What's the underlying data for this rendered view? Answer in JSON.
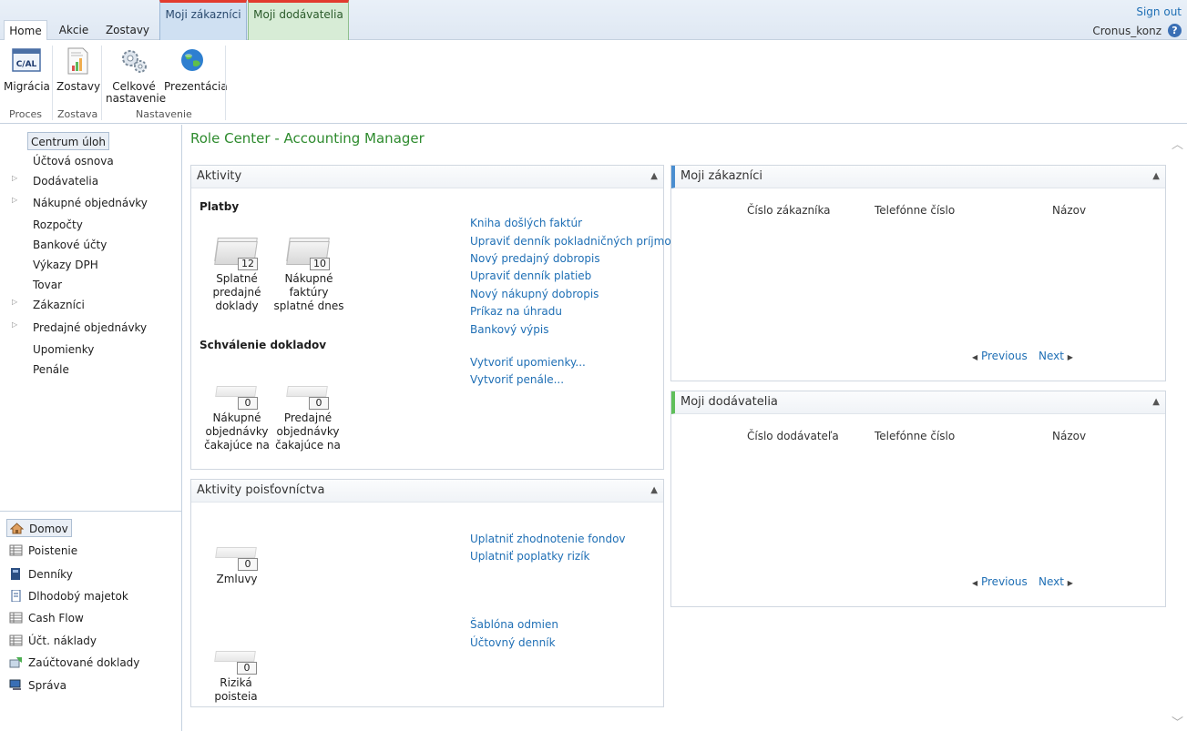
{
  "topbar": {
    "tabs": [
      "Home",
      "Akcie",
      "Zostavy"
    ],
    "context_tabs": [
      "Moji zákazníci",
      "Moji dodávatelia"
    ],
    "sign_out": "Sign out",
    "user": "Cronus_konz",
    "help": "?"
  },
  "ribbon": {
    "buttons": {
      "migracia": "Migrácia",
      "zostavy": "Zostavy",
      "celkove_1": "Celkové",
      "celkove_2": "nastavenie",
      "prezentacia": "Prezentácia"
    },
    "groups": [
      "Proces",
      "Zostava",
      "Nastavenie"
    ],
    "cal_icon_text": "C/AL"
  },
  "nav": {
    "items": [
      "Centrum úloh",
      "Účtová osnova",
      "Dodávatelia",
      "Nákupné objednávky",
      "Rozpočty",
      "Bankové účty",
      "Výkazy DPH",
      "Tovar",
      "Zákazníci",
      "Predajné objednávky",
      "Upomienky",
      "Penále"
    ],
    "bottom": [
      "Domov",
      "Poistenie",
      "Denníky",
      "Dlhodobý majetok",
      "Cash Flow",
      "Účt. náklady",
      "Zaúčtované doklady",
      "Správa"
    ]
  },
  "main": {
    "title": "Role Center - Accounting Manager",
    "aktivity": {
      "header": "Aktivity",
      "platby": "Platby",
      "schvalenie": "Schválenie dokladov",
      "cues": [
        {
          "count": "12",
          "l1": "Splatné",
          "l2": "predajné",
          "l3": "doklady"
        },
        {
          "count": "10",
          "l1": "Nákupné",
          "l2": "faktúry",
          "l3": "splatné dnes"
        },
        {
          "count": "0",
          "l1": "Nákupné",
          "l2": "objednávky",
          "l3": "čakajúce na"
        },
        {
          "count": "0",
          "l1": "Predajné",
          "l2": "objednávky",
          "l3": "čakajúce na"
        }
      ],
      "links": [
        "Kniha došlých faktúr",
        "Upraviť denník pokladničných príjmov",
        "Nový predajný dobropis",
        "Upraviť denník platieb",
        "Nový nákupný dobropis",
        "Príkaz na úhradu",
        "Bankový výpis",
        "Vytvoriť upomienky...",
        "Vytvoriť penále..."
      ]
    },
    "poistovnictvo": {
      "header": "Aktivity poisťovníctva",
      "cues": [
        {
          "count": "0",
          "label": "Zmluvy"
        },
        {
          "count": "0",
          "label": "Riziká poisteia"
        }
      ],
      "links": [
        "Uplatniť zhodnotenie fondov",
        "Uplatniť poplatky rizík",
        "Šablóna odmien",
        "Účtovný denník"
      ]
    },
    "zakaznici": {
      "header": "Moji zákazníci",
      "columns": [
        "Číslo zákazníka",
        "Telefónne číslo",
        "Názov"
      ],
      "previous": "Previous",
      "next": "Next"
    },
    "dodavatelia": {
      "header": "Moji dodávatelia",
      "columns": [
        "Číslo dodávateľa",
        "Telefónne číslo",
        "Názov"
      ],
      "previous": "Previous",
      "next": "Next"
    }
  }
}
